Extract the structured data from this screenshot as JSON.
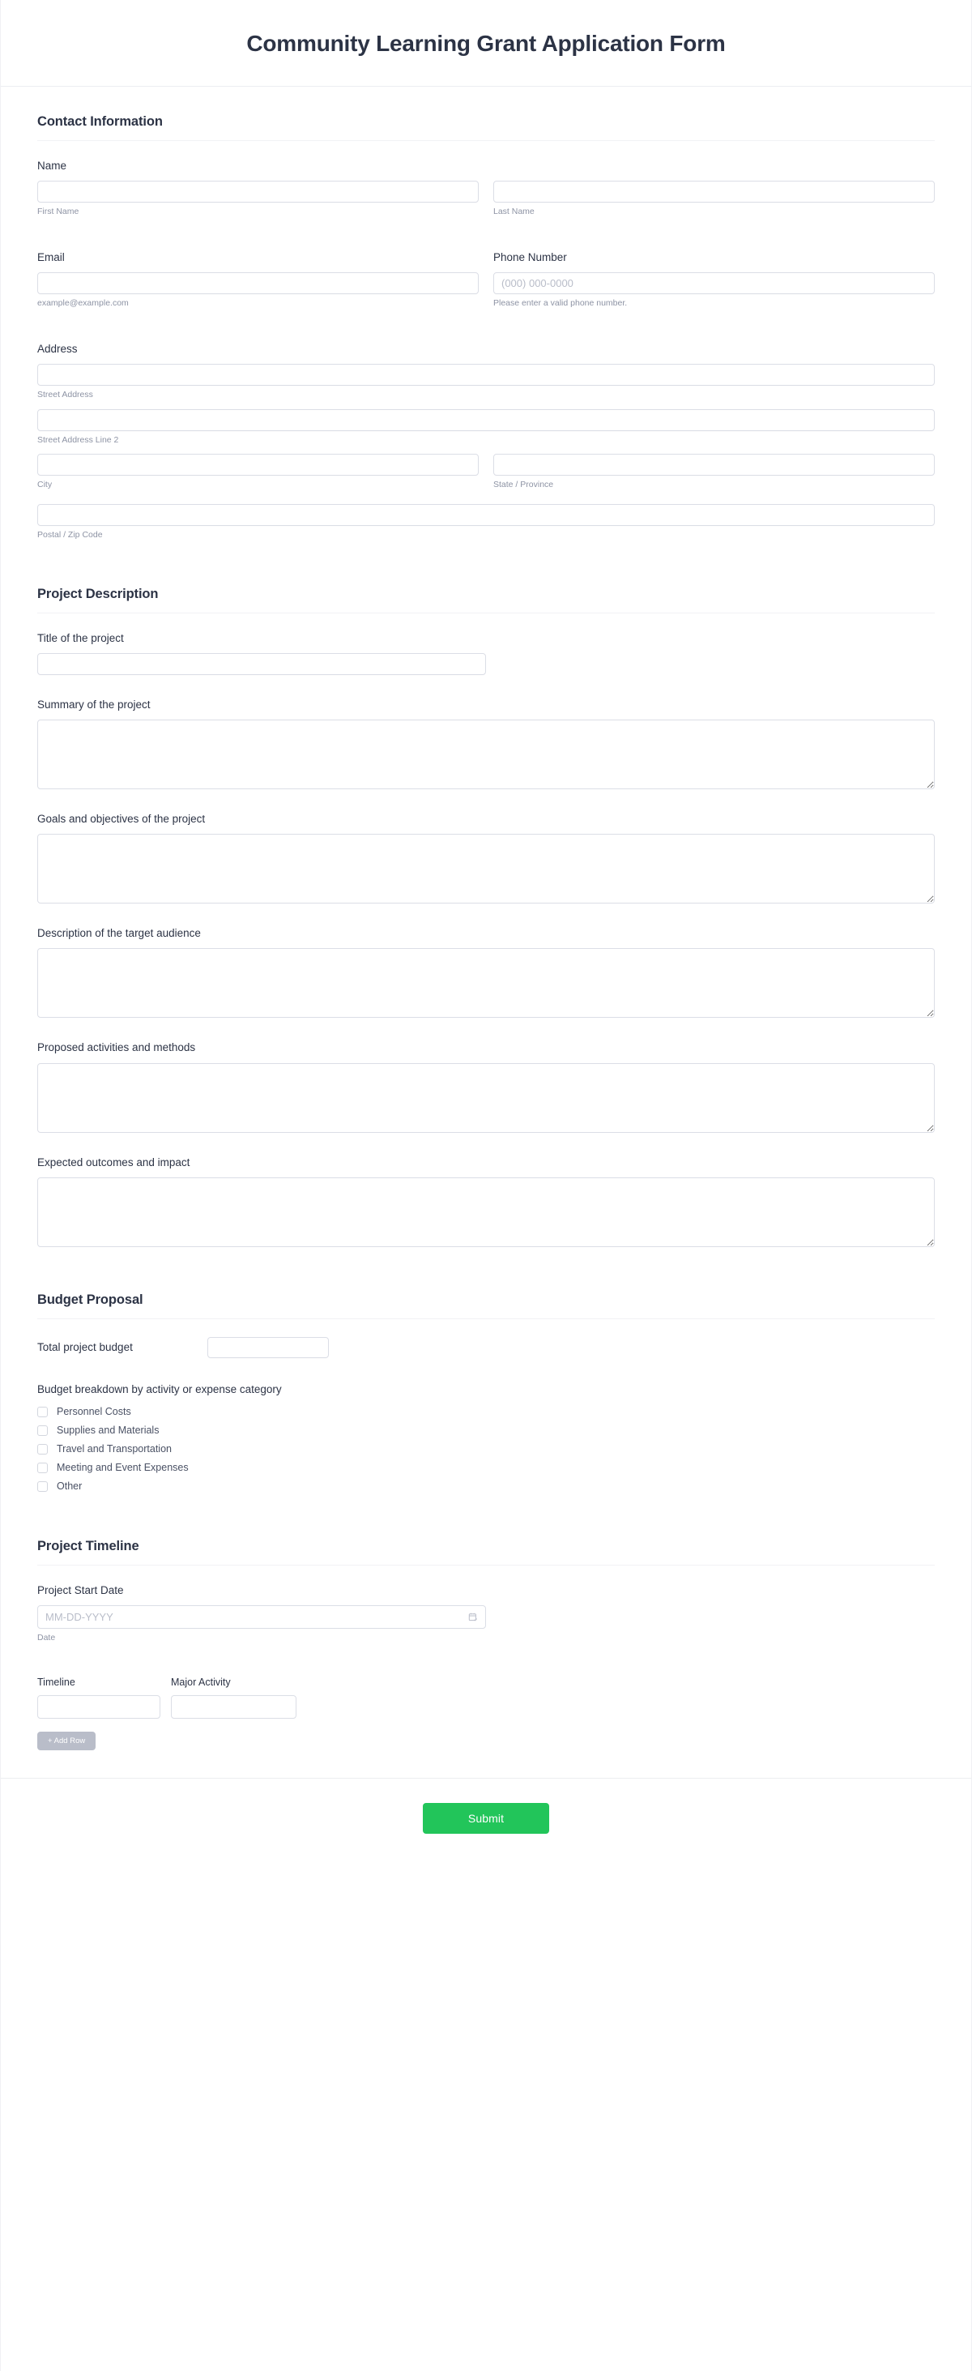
{
  "header": {
    "title": "Community Learning Grant Application Form"
  },
  "sections": {
    "contact": {
      "heading": "Contact Information",
      "name": {
        "label": "Name",
        "first_sub": "First Name",
        "last_sub": "Last Name",
        "first_value": "",
        "last_value": ""
      },
      "email": {
        "label": "Email",
        "sub": "example@example.com",
        "value": ""
      },
      "phone": {
        "label": "Phone Number",
        "placeholder": "(000) 000-0000",
        "sub": "Please enter a valid phone number.",
        "value": ""
      },
      "address": {
        "label": "Address",
        "street_sub": "Street Address",
        "street2_sub": "Street Address Line 2",
        "city_sub": "City",
        "state_sub": "State / Province",
        "zip_sub": "Postal / Zip Code",
        "street_value": "",
        "street2_value": "",
        "city_value": "",
        "state_value": "",
        "zip_value": ""
      }
    },
    "project": {
      "heading": "Project Description",
      "title_label": "Title of the project",
      "title_value": "",
      "summary_label": "Summary of the project",
      "summary_value": "",
      "goals_label": "Goals and objectives of the project",
      "goals_value": "",
      "audience_label": "Description of the target audience",
      "audience_value": "",
      "activities_label": "Proposed activities and methods",
      "activities_value": "",
      "outcomes_label": "Expected outcomes and impact",
      "outcomes_value": ""
    },
    "budget": {
      "heading": "Budget Proposal",
      "total_label": "Total project budget",
      "total_value": "",
      "breakdown_label": "Budget breakdown by activity or expense category",
      "options": [
        "Personnel Costs",
        "Supplies and Materials",
        "Travel and Transportation",
        "Meeting and Event Expenses",
        "Other"
      ]
    },
    "timeline": {
      "heading": "Project Timeline",
      "start_label": "Project Start Date",
      "start_placeholder": "MM-DD-YYYY",
      "start_value": "",
      "start_sub": "Date",
      "col_timeline": "Timeline",
      "col_activity": "Major Activity",
      "timeline_value": "",
      "activity_value": "",
      "add_row_label": "+ Add Row"
    }
  },
  "footer": {
    "submit_label": "Submit"
  },
  "colors": {
    "accent_green": "#22c55a",
    "heading_navy": "#2c3345",
    "muted_gray": "#8d93a4",
    "add_row_gray": "#b9bdc9"
  }
}
